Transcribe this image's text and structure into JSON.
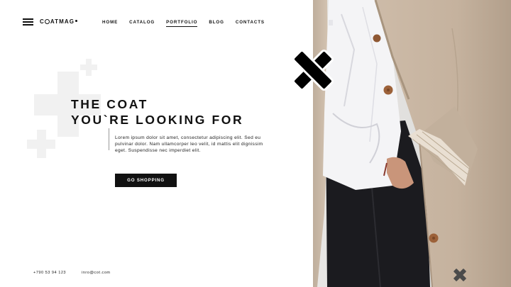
{
  "brand": {
    "logo_c": "C",
    "logo_rest": "ATMAG"
  },
  "nav": [
    {
      "label": "HOME",
      "active": false
    },
    {
      "label": "CATALOG",
      "active": false
    },
    {
      "label": "PORTFOLIO",
      "active": true
    },
    {
      "label": "BLOG",
      "active": false
    },
    {
      "label": "CONTACTS",
      "active": false
    }
  ],
  "hero": {
    "title_line1": "THE COAT",
    "title_line2": "YOU`RE LOOKING FOR",
    "description": "Lorem ipsum dolor sit amet, consectetur adipiscing elit. Sed eu pulvinar dolor. Nam ullamcorper leo velit, id mattis elit dignissim eget. Suspendisse nec imperdiet elit.",
    "button_label": "GO SHOPPING"
  },
  "footer": {
    "phone": "+790 53 94 123",
    "email": "inro@cot.com"
  },
  "colors": {
    "accent": "#111111",
    "background": "#ffffff",
    "coat": "#c9b8a6",
    "shirt": "#f3f3f5"
  },
  "icons": [
    "hamburger-menu-icon",
    "cross-decoration-icon"
  ]
}
